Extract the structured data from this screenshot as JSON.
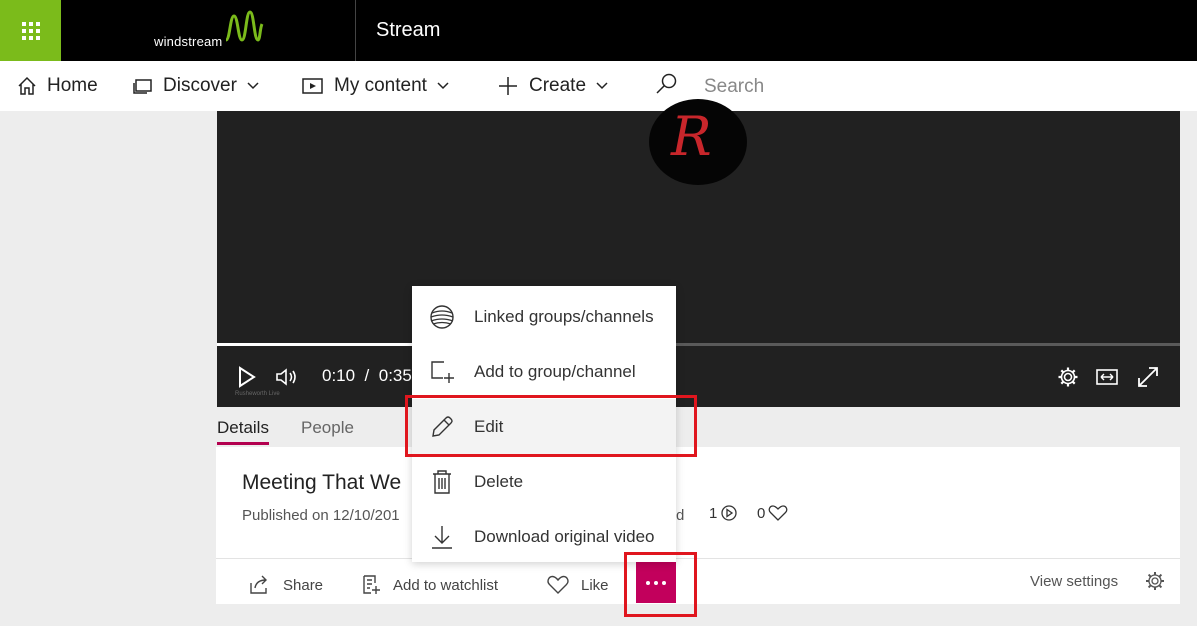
{
  "header": {
    "brand": "windstream",
    "app_title": "Stream"
  },
  "nav": {
    "home": "Home",
    "discover": "Discover",
    "my_content": "My content",
    "create": "Create",
    "search_placeholder": "Search"
  },
  "player": {
    "current_time": "0:10",
    "separator": "/",
    "duration": "0:35",
    "progress": 0.29,
    "watermark": "Rusheworth Live"
  },
  "tabs": {
    "details": "Details",
    "people": "People"
  },
  "video": {
    "title": "Meeting That We",
    "published": "Published on 12/10/201",
    "partial_text": "d",
    "views": "1",
    "likes": "0"
  },
  "actions": {
    "share": "Share",
    "watchlist": "Add to watchlist",
    "like": "Like",
    "view_settings": "View settings"
  },
  "menu": {
    "items": [
      {
        "label": "Linked groups/channels",
        "icon": "globe-icon"
      },
      {
        "label": "Add to group/channel",
        "icon": "add-group-icon"
      },
      {
        "label": "Edit",
        "icon": "pencil-icon"
      },
      {
        "label": "Delete",
        "icon": "trash-icon"
      },
      {
        "label": "Download original video",
        "icon": "download-icon"
      }
    ]
  },
  "colors": {
    "brand_green": "#7bbb1b",
    "accent_magenta": "#c2005c",
    "highlight_red": "#e0161e"
  }
}
